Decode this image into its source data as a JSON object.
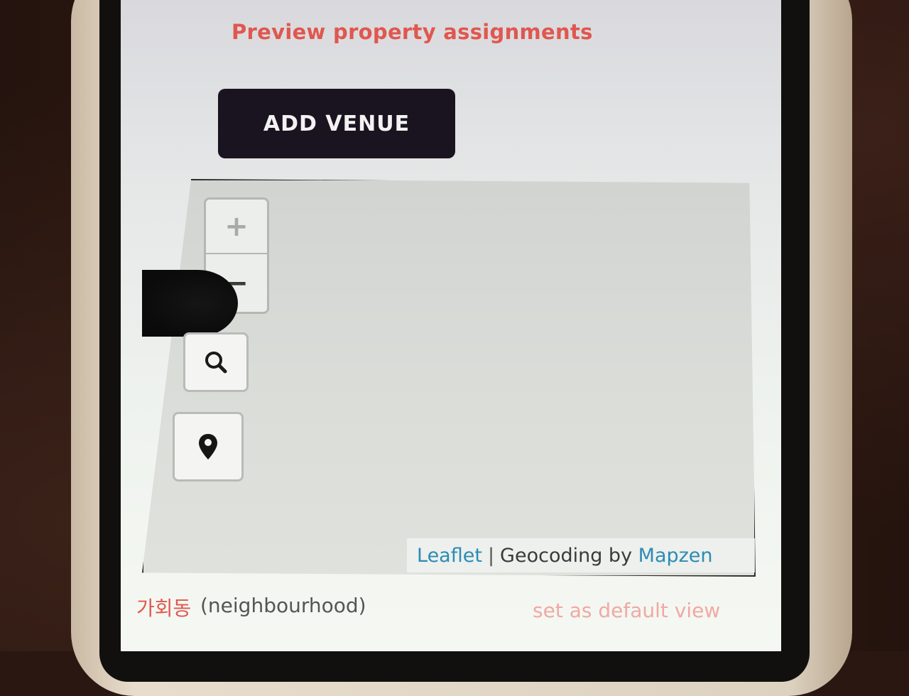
{
  "preview": {
    "link_label": "Preview property assignments"
  },
  "actions": {
    "add_venue_label": "ADD VENUE"
  },
  "map": {
    "zoom_in_label": "+",
    "zoom_out_label": "−",
    "search_icon": "search-icon",
    "locate_icon": "map-pin-icon",
    "attribution": {
      "leaflet_label": "Leaflet",
      "separator": "|",
      "geocoding_text": "Geocoding by",
      "mapzen_label": "Mapzen"
    }
  },
  "location": {
    "name": "가회동",
    "type": "(neighbourhood)",
    "default_view_label": "set as default view"
  },
  "colors": {
    "accent": "#e0574f",
    "link_blue": "#2c8bb5",
    "button_dark": "#1a1420"
  }
}
